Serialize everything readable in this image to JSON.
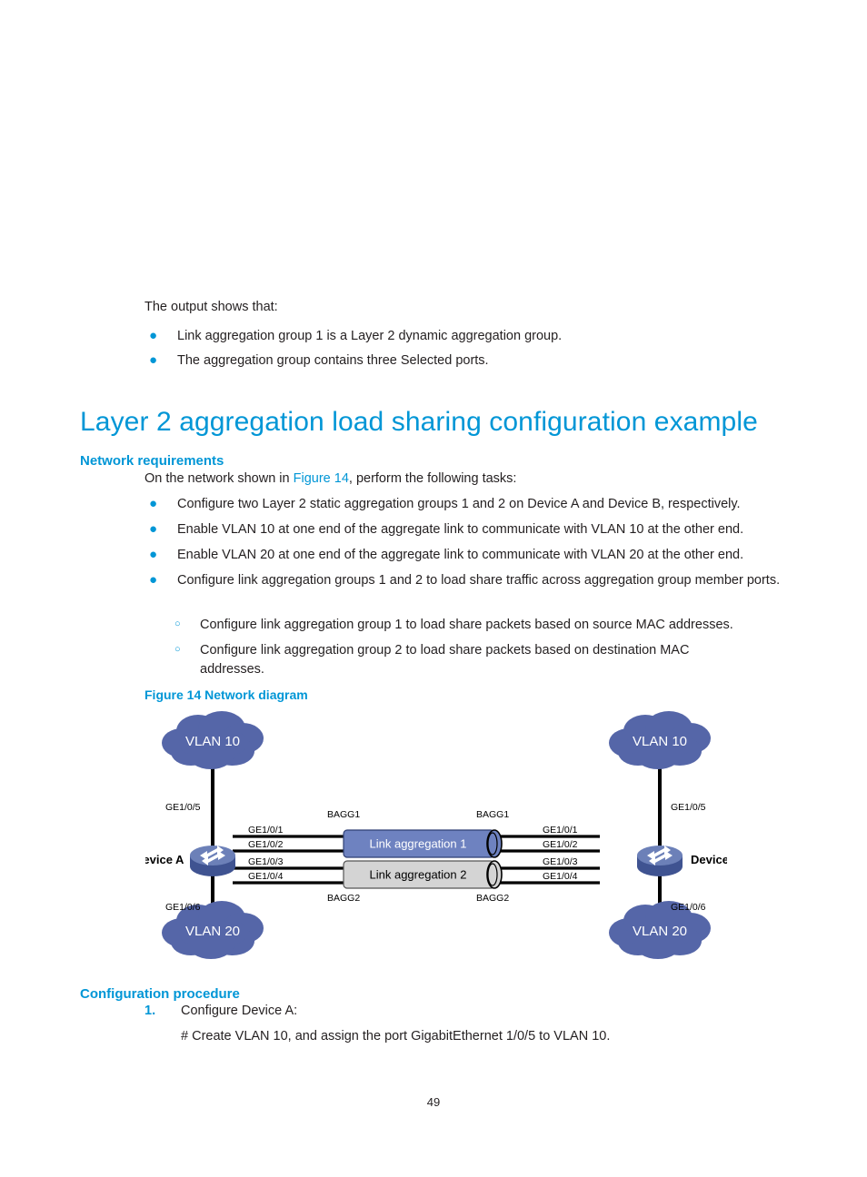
{
  "document": {
    "page_number": "49"
  },
  "intro": {
    "lead": "The output shows that:",
    "bullets": [
      "Link aggregation group 1 is a Layer 2 dynamic aggregation group.",
      "The aggregation group contains three Selected ports."
    ]
  },
  "section": {
    "title": "Layer 2 aggregation load sharing configuration example"
  },
  "network_requirements": {
    "heading": "Network requirements",
    "lead_prefix": "On the network shown in ",
    "lead_link": "Figure 14",
    "lead_suffix": ", perform the following tasks:",
    "bullets": [
      "Configure two Layer 2 static aggregation groups 1 and 2 on Device A and Device B, respectively.",
      "Enable VLAN 10 at one end of the aggregate link to communicate with VLAN 10 at the other end.",
      "Enable VLAN 20 at one end of the aggregate link to communicate with VLAN 20 at the other end.",
      "Configure link aggregation groups 1 and 2 to load share traffic across aggregation group member ports."
    ],
    "sub_bullets": [
      "Configure link aggregation group 1 to load share packets based on source MAC addresses.",
      "Configure link aggregation group 2 to load share packets based on destination MAC addresses."
    ]
  },
  "figure": {
    "caption": "Figure 14 Network diagram",
    "diagram": {
      "clouds": [
        {
          "label": "VLAN 10",
          "side": "left",
          "position": "top"
        },
        {
          "label": "VLAN 20",
          "side": "left",
          "position": "bottom"
        },
        {
          "label": "VLAN 10",
          "side": "right",
          "position": "top"
        },
        {
          "label": "VLAN 20",
          "side": "right",
          "position": "bottom"
        }
      ],
      "devices": [
        {
          "label": "Device A",
          "side": "left"
        },
        {
          "label": "Device B",
          "side": "right"
        }
      ],
      "uplink_ports": {
        "left_top": "GE1/0/5",
        "left_bottom": "GE1/0/6",
        "right_top": "GE1/0/5",
        "right_bottom": "GE1/0/6"
      },
      "member_ports_left": [
        "GE1/0/1",
        "GE1/0/2",
        "GE1/0/3",
        "GE1/0/4"
      ],
      "member_ports_right": [
        "GE1/0/1",
        "GE1/0/2",
        "GE1/0/3",
        "GE1/0/4"
      ],
      "bagg_labels": {
        "left_top": "BAGG1",
        "left_bottom": "BAGG2",
        "right_top": "BAGG1",
        "right_bottom": "BAGG2"
      },
      "aggregations": [
        {
          "label": "Link aggregation 1",
          "fill": "#6e82c0"
        },
        {
          "label": "Link aggregation 2",
          "fill": "#d4d4d4"
        }
      ]
    }
  },
  "configuration_procedure": {
    "heading": "Configuration procedure",
    "steps": [
      {
        "number": "1.",
        "text": "Configure Device A:"
      }
    ],
    "commands": [
      "# Create VLAN 10, and assign the port GigabitEthernet 1/0/5 to VLAN 10."
    ]
  },
  "colors": {
    "accent": "#0096d6",
    "cloud": "#5566a8",
    "device": "#5b6ea8",
    "agg1": "#6e82c0",
    "agg2": "#d4d4d4",
    "text": "#231f20"
  }
}
